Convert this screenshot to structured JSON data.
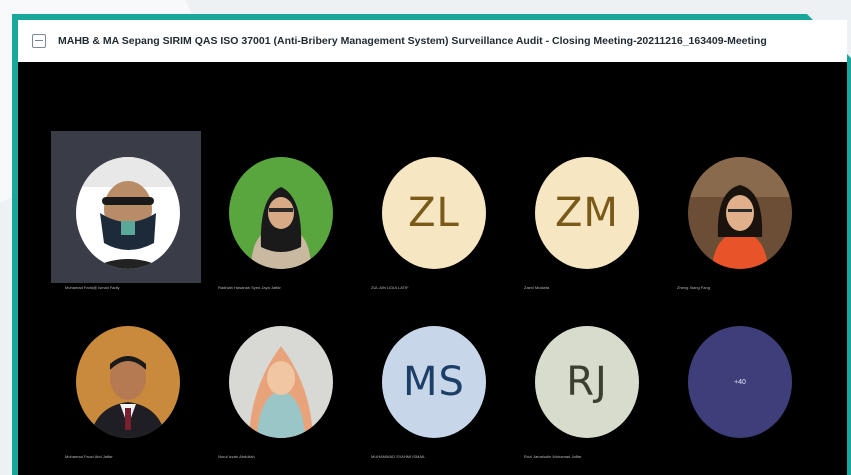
{
  "window": {
    "title": "MAHB & MA Sepang SIRIM QAS ISO 37001 (Anti-Bribery Management System) Surveillance Audit - Closing Meeting-20211216_163409-Meeting"
  },
  "colors": {
    "frame": "#1aa79b",
    "tile_active": "#3a3d47",
    "initials_bg_cream": "#f6e6c1",
    "initials_fg_brown": "#7a5a19",
    "initials_bg_blue": "#c8d6ea",
    "initials_fg_blue": "#1c3f68",
    "initials_bg_gray": "#d8dccd",
    "initials_fg_gray": "#3b3f2f",
    "overflow_bg": "#3e3f7a"
  },
  "participants": [
    {
      "initials": "",
      "name": "Mohamad Farid@ Ismail Fadly",
      "type": "photo",
      "active": true
    },
    {
      "initials": "",
      "name": "Radhiah Hasanah Syed Jaya Jaffar",
      "type": "photo"
    },
    {
      "initials": "ZL",
      "name": "ZUL AIN LIDIA LATIF",
      "type": "initials"
    },
    {
      "initials": "ZM",
      "name": "Zaimi Mustafa",
      "type": "initials"
    },
    {
      "initials": "",
      "name": "Zheng Xiang Fang",
      "type": "photo"
    },
    {
      "initials": "",
      "name": "Mohamad Fauzi Abd Jaffar",
      "type": "photo"
    },
    {
      "initials": "",
      "name": "Nurul Izzah Abdullah",
      "type": "photo"
    },
    {
      "initials": "MS",
      "name": "MUHAMMAD SYAHMI ISMAIL",
      "type": "initials"
    },
    {
      "initials": "RJ",
      "name": "Rozi Jamaludin Mohamad Jaffar",
      "type": "initials"
    },
    {
      "initials": "+40",
      "name": "",
      "type": "overflow"
    }
  ]
}
